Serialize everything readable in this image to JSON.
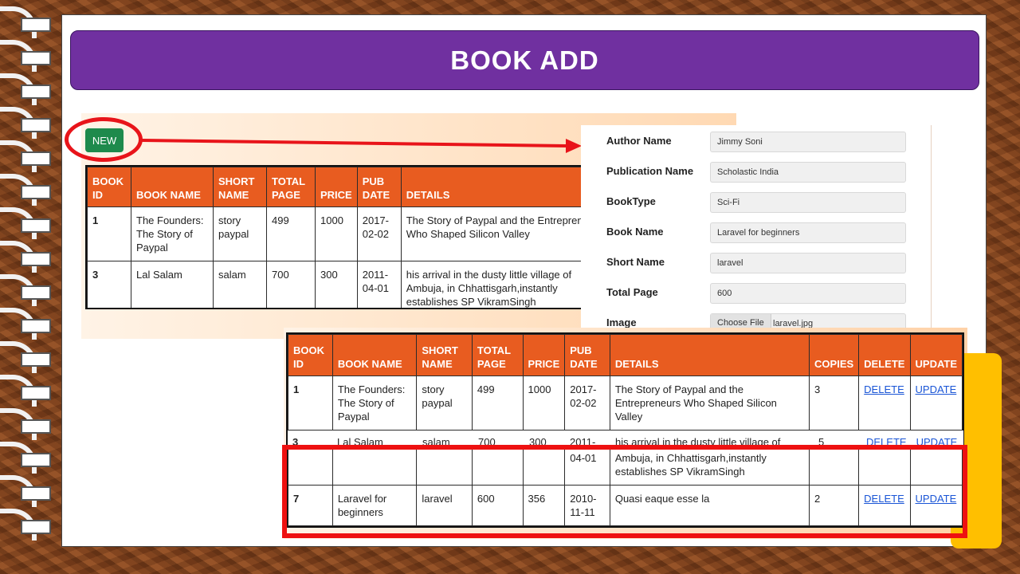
{
  "slide": {
    "title": "BOOK ADD"
  },
  "new_button": {
    "label": "NEW"
  },
  "table1": {
    "headers": [
      "BOOK ID",
      "BOOK NAME",
      "SHORT NAME",
      "TOTAL PAGE",
      "PRICE",
      "PUB DATE",
      "DETAILS"
    ],
    "rows": [
      {
        "id": "1",
        "book_name": "The Founders: The Story of Paypal",
        "short_name": "story paypal",
        "total_page": "499",
        "price": "1000",
        "pub_date": "2017-02-02",
        "details": "The Story of Paypal and the Entrepreneurs Who Shaped Silicon Valley"
      },
      {
        "id": "3",
        "book_name": "Lal Salam",
        "short_name": "salam",
        "total_page": "700",
        "price": "300",
        "pub_date": "2011-04-01",
        "details": "his arrival in the dusty little village of Ambuja, in Chhattisgarh,instantly establishes SP VikramSingh"
      }
    ]
  },
  "form": {
    "fields": [
      {
        "label": "Author Name",
        "value": "Jimmy Soni"
      },
      {
        "label": "Publication Name",
        "value": "Scholastic India"
      },
      {
        "label": "BookType",
        "value": "Sci-Fi"
      },
      {
        "label": "Book Name",
        "value": "Laravel for beginners"
      },
      {
        "label": "Short Name",
        "value": "laravel"
      },
      {
        "label": "Total Page",
        "value": "600"
      }
    ],
    "image": {
      "label": "Image",
      "button": "Choose File",
      "file": "laravel.jpg"
    }
  },
  "table2": {
    "headers": [
      "BOOK ID",
      "BOOK NAME",
      "SHORT NAME",
      "TOTAL PAGE",
      "PRICE",
      "PUB DATE",
      "DETAILS",
      "COPIES",
      "DELETE",
      "UPDATE"
    ],
    "rows": [
      {
        "id": "1",
        "book_name": "The Founders: The Story of Paypal",
        "short_name": "story paypal",
        "total_page": "499",
        "price": "1000",
        "pub_date": "2017-02-02",
        "details": "The Story of Paypal and the Entrepreneurs Who Shaped Silicon Valley",
        "copies": "3",
        "delete": "DELETE",
        "update": "UPDATE"
      },
      {
        "id": "3",
        "book_name": "Lal Salam",
        "short_name": "salam",
        "total_page": "700",
        "price": "300",
        "pub_date": "2011-04-01",
        "details": "his arrival in the dusty little village of Ambuja, in Chhattisgarh,instantly establishes SP VikramSingh",
        "copies": "5",
        "delete": "DELETE",
        "update": "UPDATE"
      },
      {
        "id": "7",
        "book_name": "Laravel for beginners",
        "short_name": "laravel",
        "total_page": "600",
        "price": "356",
        "pub_date": "2010-11-11",
        "details": "Quasi eaque esse la",
        "copies": "2",
        "delete": "DELETE",
        "update": "UPDATE"
      }
    ],
    "overlap_row": {
      "id": "3",
      "book_name": "Lal Salam",
      "short_name": "salam",
      "total_page": "700",
      "price": "300",
      "pub_date": "2011-",
      "details": "his arrival in the dusty little village of",
      "copies": "5",
      "delete": "DELETE",
      "update": "UPDATE",
      "pub_date_rest": "04-01",
      "details_rest": "Ambuja, in Chhattisgarh,instantly establishes SP VikramSingh"
    }
  },
  "colors": {
    "title_bar": "#7030a0",
    "table_header": "#e85c20",
    "new_button": "#1e8a4c",
    "highlight": "#ee1111",
    "accent_block": "#ffbf00"
  }
}
